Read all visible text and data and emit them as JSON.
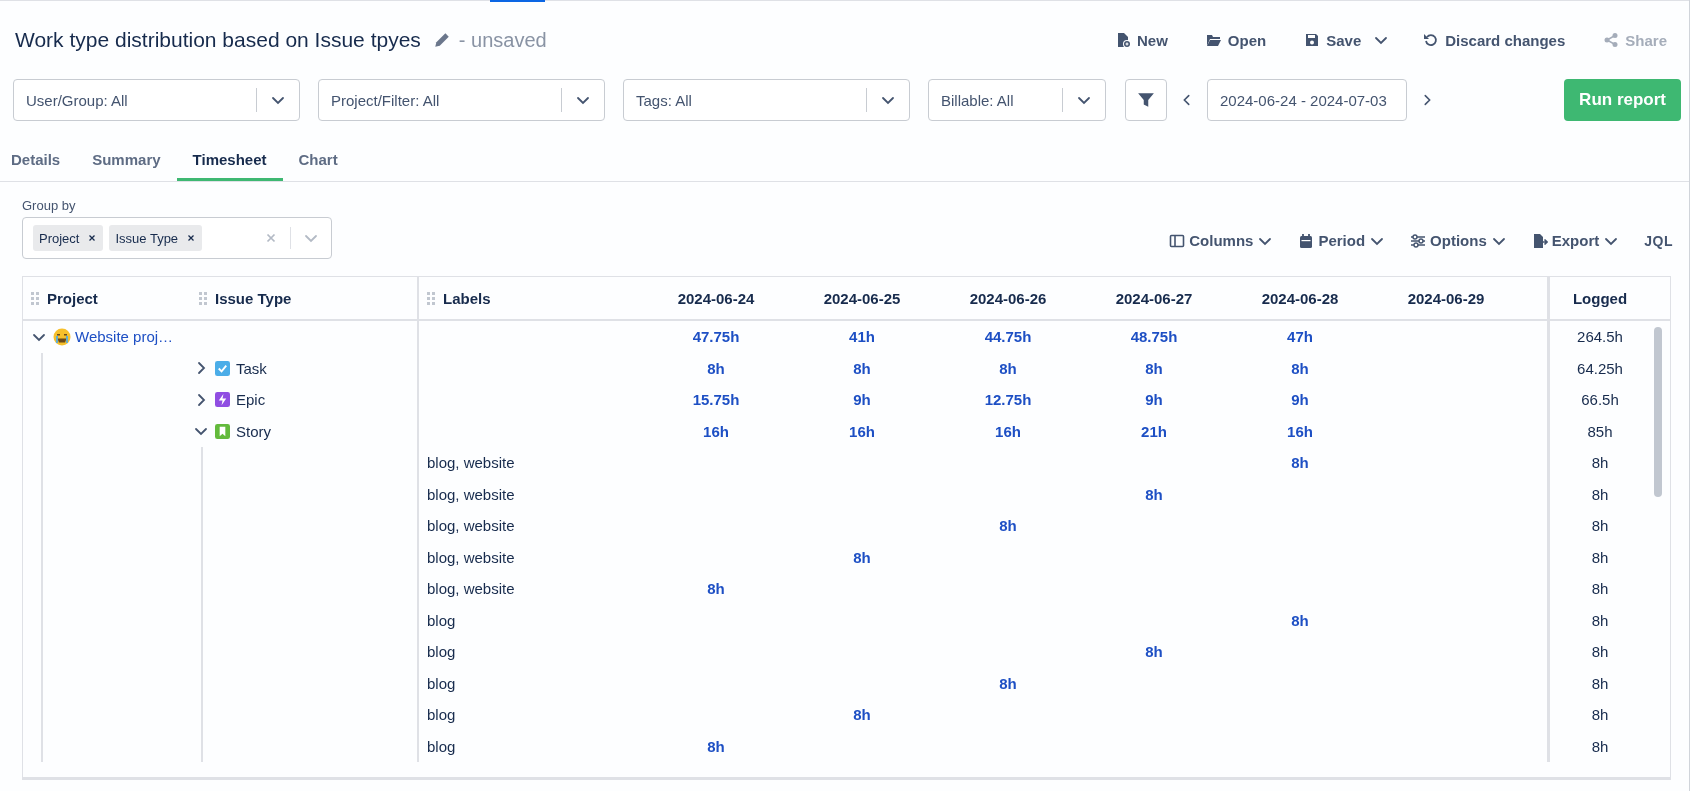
{
  "report": {
    "title": "Work type distribution based on Issue tpyes",
    "status": "- unsaved"
  },
  "actions": [
    {
      "kind": "new",
      "label": "New",
      "disabled": false
    },
    {
      "kind": "open",
      "label": "Open",
      "disabled": false
    },
    {
      "kind": "save",
      "label": "Save",
      "disabled": false
    },
    {
      "kind": "discard",
      "label": "Discard changes",
      "disabled": false
    },
    {
      "kind": "share",
      "label": "Share",
      "disabled": true
    }
  ],
  "filters": [
    "User/Group: All",
    "Project/Filter: All",
    "Tags: All",
    "Billable: All"
  ],
  "date_range": {
    "value": "2024-06-24 - 2024-07-03"
  },
  "run_button": "Run report",
  "tabs": [
    {
      "label": "Details",
      "selected": false
    },
    {
      "label": "Summary",
      "selected": false
    },
    {
      "label": "Timesheet",
      "selected": true
    },
    {
      "label": "Chart",
      "selected": false
    }
  ],
  "group_by": {
    "label": "Group by",
    "chips": [
      "Project",
      "Issue Type"
    ]
  },
  "view_tools": [
    {
      "kind": "columns",
      "label": "Columns"
    },
    {
      "kind": "period",
      "label": "Period"
    },
    {
      "kind": "options",
      "label": "Options"
    },
    {
      "kind": "export",
      "label": "Export"
    },
    {
      "kind": "jql",
      "label": "JQL"
    }
  ],
  "table": {
    "columns": {
      "groups": [
        "Project",
        "Issue Type"
      ],
      "labels": "Labels",
      "dates": [
        "2024-06-24",
        "2024-06-25",
        "2024-06-26",
        "2024-06-27",
        "2024-06-28",
        "2024-06-29"
      ],
      "total": "Logged"
    },
    "rows": [
      {
        "kind": "project",
        "name": "Website proj…",
        "expanded": true,
        "values": [
          {
            "kind": "hours",
            "hours": "47.75h"
          },
          {
            "kind": "hours",
            "hours": "41h"
          },
          {
            "kind": "hours",
            "hours": "44.75h"
          },
          {
            "kind": "hours",
            "hours": "48.75h"
          },
          {
            "kind": "hours",
            "hours": "47h"
          },
          {
            "kind": "blank"
          }
        ],
        "logged": "264.5h",
        "children": [
          {
            "kind": "task",
            "color": "#4bade8",
            "name": "Task",
            "expanded": false,
            "values": [
              {
                "kind": "hours",
                "hours": "8h"
              },
              {
                "kind": "hours",
                "hours": "8h"
              },
              {
                "kind": "hours",
                "hours": "8h"
              },
              {
                "kind": "hours",
                "hours": "8h"
              },
              {
                "kind": "hours",
                "hours": "8h"
              },
              {
                "kind": "blank"
              }
            ],
            "logged": "64.25h"
          },
          {
            "kind": "epic",
            "color": "#904ee2",
            "name": "Epic",
            "expanded": false,
            "values": [
              {
                "kind": "hours",
                "hours": "15.75h"
              },
              {
                "kind": "hours",
                "hours": "9h"
              },
              {
                "kind": "hours",
                "hours": "12.75h"
              },
              {
                "kind": "hours",
                "hours": "9h"
              },
              {
                "kind": "hours",
                "hours": "9h"
              },
              {
                "kind": "blank"
              }
            ],
            "logged": "66.5h"
          },
          {
            "kind": "story",
            "color": "#63ba3c",
            "name": "Story",
            "expanded": true,
            "values": [
              {
                "kind": "hours",
                "hours": "16h"
              },
              {
                "kind": "hours",
                "hours": "16h"
              },
              {
                "kind": "hours",
                "hours": "16h"
              },
              {
                "kind": "hours",
                "hours": "21h"
              },
              {
                "kind": "hours",
                "hours": "16h"
              },
              {
                "kind": "blank"
              }
            ],
            "logged": "85h",
            "children": [
              {
                "kind": "label",
                "name": "blog, website",
                "values": [
                  {
                    "kind": "blank"
                  },
                  {
                    "kind": "blank"
                  },
                  {
                    "kind": "blank"
                  },
                  {
                    "kind": "blank"
                  },
                  {
                    "kind": "hours",
                    "hours": "8h"
                  },
                  {
                    "kind": "blank"
                  }
                ],
                "logged": "8h"
              },
              {
                "kind": "label",
                "name": "blog, website",
                "values": [
                  {
                    "kind": "blank"
                  },
                  {
                    "kind": "blank"
                  },
                  {
                    "kind": "blank"
                  },
                  {
                    "kind": "hours",
                    "hours": "8h"
                  },
                  {
                    "kind": "blank"
                  },
                  {
                    "kind": "blank"
                  }
                ],
                "logged": "8h"
              },
              {
                "kind": "label",
                "name": "blog, website",
                "values": [
                  {
                    "kind": "blank"
                  },
                  {
                    "kind": "blank"
                  },
                  {
                    "kind": "hours",
                    "hours": "8h"
                  },
                  {
                    "kind": "blank"
                  },
                  {
                    "kind": "blank"
                  },
                  {
                    "kind": "blank"
                  }
                ],
                "logged": "8h"
              },
              {
                "kind": "label",
                "name": "blog, website",
                "values": [
                  {
                    "kind": "blank"
                  },
                  {
                    "kind": "hours",
                    "hours": "8h"
                  },
                  {
                    "kind": "blank"
                  },
                  {
                    "kind": "blank"
                  },
                  {
                    "kind": "blank"
                  },
                  {
                    "kind": "blank"
                  }
                ],
                "logged": "8h"
              },
              {
                "kind": "label",
                "name": "blog, website",
                "values": [
                  {
                    "kind": "hours",
                    "hours": "8h"
                  },
                  {
                    "kind": "blank"
                  },
                  {
                    "kind": "blank"
                  },
                  {
                    "kind": "blank"
                  },
                  {
                    "kind": "blank"
                  },
                  {
                    "kind": "blank"
                  }
                ],
                "logged": "8h"
              },
              {
                "kind": "label",
                "name": "blog",
                "values": [
                  {
                    "kind": "blank"
                  },
                  {
                    "kind": "blank"
                  },
                  {
                    "kind": "blank"
                  },
                  {
                    "kind": "blank"
                  },
                  {
                    "kind": "hours",
                    "hours": "8h"
                  },
                  {
                    "kind": "blank"
                  }
                ],
                "logged": "8h"
              },
              {
                "kind": "label",
                "name": "blog",
                "values": [
                  {
                    "kind": "blank"
                  },
                  {
                    "kind": "blank"
                  },
                  {
                    "kind": "blank"
                  },
                  {
                    "kind": "hours",
                    "hours": "8h"
                  },
                  {
                    "kind": "blank"
                  },
                  {
                    "kind": "blank"
                  }
                ],
                "logged": "8h"
              },
              {
                "kind": "label",
                "name": "blog",
                "values": [
                  {
                    "kind": "blank"
                  },
                  {
                    "kind": "blank"
                  },
                  {
                    "kind": "hours",
                    "hours": "8h"
                  },
                  {
                    "kind": "blank"
                  },
                  {
                    "kind": "blank"
                  },
                  {
                    "kind": "blank"
                  }
                ],
                "logged": "8h"
              },
              {
                "kind": "label",
                "name": "blog",
                "values": [
                  {
                    "kind": "blank"
                  },
                  {
                    "kind": "hours",
                    "hours": "8h"
                  },
                  {
                    "kind": "blank"
                  },
                  {
                    "kind": "blank"
                  },
                  {
                    "kind": "blank"
                  },
                  {
                    "kind": "blank"
                  }
                ],
                "logged": "8h"
              },
              {
                "kind": "label",
                "name": "blog",
                "values": [
                  {
                    "kind": "hours",
                    "hours": "8h"
                  },
                  {
                    "kind": "blank"
                  },
                  {
                    "kind": "blank"
                  },
                  {
                    "kind": "blank"
                  },
                  {
                    "kind": "blank"
                  },
                  {
                    "kind": "blank"
                  }
                ],
                "logged": "8h"
              }
            ]
          }
        ]
      }
    ]
  }
}
